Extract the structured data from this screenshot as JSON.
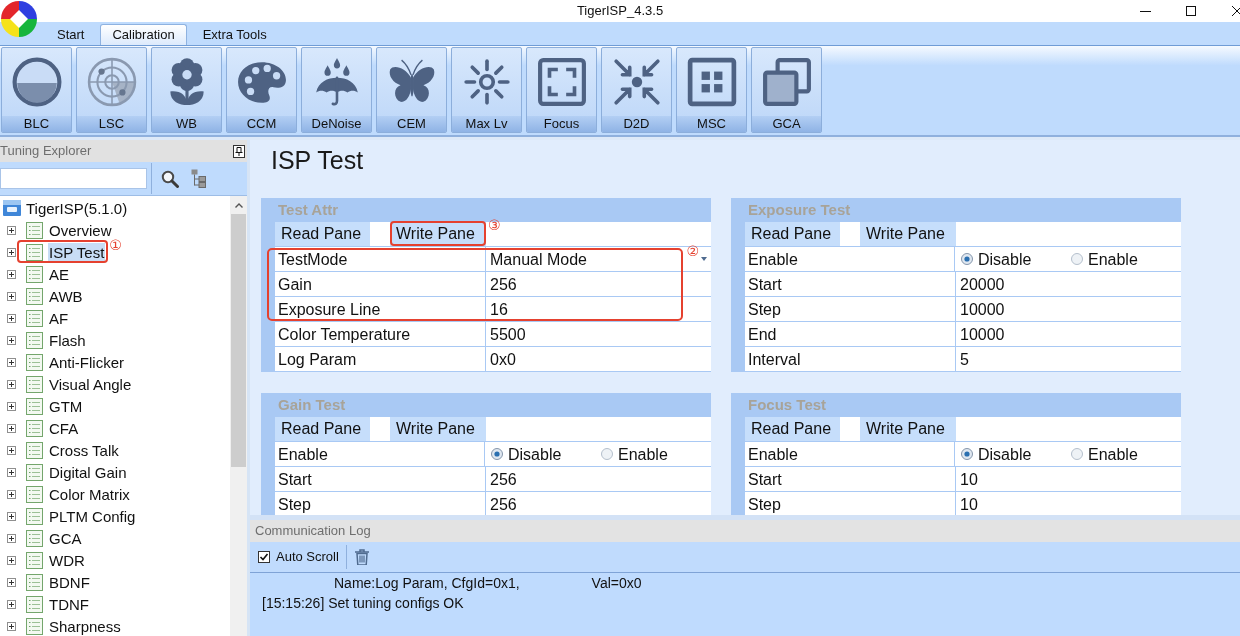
{
  "window": {
    "title": "TigerISP_4.3.5"
  },
  "ribbon_tabs": [
    {
      "label": "Start",
      "selected": false
    },
    {
      "label": "Calibration",
      "selected": true
    },
    {
      "label": "Extra Tools",
      "selected": false
    }
  ],
  "ribbon_buttons": [
    {
      "label": "BLC",
      "kind": "blc"
    },
    {
      "label": "LSC",
      "kind": "lsc"
    },
    {
      "label": "WB",
      "kind": "wb"
    },
    {
      "label": "CCM",
      "kind": "ccm"
    },
    {
      "label": "DeNoise",
      "kind": "denoise"
    },
    {
      "label": "CEM",
      "kind": "cem"
    },
    {
      "label": "Max Lv",
      "kind": "maxlv"
    },
    {
      "label": "Focus",
      "kind": "focus"
    },
    {
      "label": "D2D",
      "kind": "d2d"
    },
    {
      "label": "MSC",
      "kind": "msc"
    },
    {
      "label": "GCA",
      "kind": "gca"
    }
  ],
  "explorer": {
    "title": "Tuning Explorer",
    "tree": {
      "label": "TigerISP(5.1.0)",
      "children": [
        {
          "label": "Overview",
          "expanded": false,
          "selected": false
        },
        {
          "label": "ISP Test",
          "expanded": false,
          "selected": true,
          "annotation": "①"
        },
        {
          "label": "AE",
          "expanded": false,
          "selected": false
        },
        {
          "label": "AWB",
          "expanded": false,
          "selected": false
        },
        {
          "label": "AF",
          "expanded": false,
          "selected": false
        },
        {
          "label": "Flash",
          "expanded": false,
          "selected": false
        },
        {
          "label": "Anti-Flicker",
          "expanded": false,
          "selected": false
        },
        {
          "label": "Visual Angle",
          "expanded": false,
          "selected": false
        },
        {
          "label": "GTM",
          "expanded": false,
          "selected": false
        },
        {
          "label": "CFA",
          "expanded": false,
          "selected": false
        },
        {
          "label": "Cross Talk",
          "expanded": false,
          "selected": false
        },
        {
          "label": "Digital Gain",
          "expanded": false,
          "selected": false
        },
        {
          "label": "Color Matrix",
          "expanded": false,
          "selected": false
        },
        {
          "label": "PLTM Config",
          "expanded": false,
          "selected": false
        },
        {
          "label": "GCA",
          "expanded": false,
          "selected": false
        },
        {
          "label": "WDR",
          "expanded": false,
          "selected": false
        },
        {
          "label": "BDNF",
          "expanded": false,
          "selected": false
        },
        {
          "label": "TDNF",
          "expanded": false,
          "selected": false
        },
        {
          "label": "Sharpness",
          "expanded": false,
          "selected": false
        }
      ]
    }
  },
  "page": {
    "title": "ISP Test",
    "panels": [
      {
        "title": "Test Attr",
        "tabs": [
          {
            "label": "Read Pane"
          },
          {
            "label": "Write Pane",
            "annotation": "③"
          }
        ],
        "annotation": "②",
        "rows": [
          {
            "label": "TestMode",
            "kind": "select",
            "value": "Manual Mode",
            "annotated": true
          },
          {
            "label": "Gain",
            "kind": "text",
            "value": "256",
            "annotated": true
          },
          {
            "label": "Exposure Line",
            "kind": "text",
            "value": "16",
            "annotated": true
          },
          {
            "label": "Color Temperature",
            "kind": "text",
            "value": "5500",
            "annotated": false
          },
          {
            "label": "Log Param",
            "kind": "text",
            "value": "0x0",
            "annotated": false
          }
        ]
      },
      {
        "title": "Exposure Test",
        "tabs": [
          {
            "label": "Read Pane"
          },
          {
            "label": "Write Pane"
          }
        ],
        "rows": [
          {
            "label": "Enable",
            "kind": "radio",
            "options": [
              {
                "label": "Disable",
                "selected": true
              },
              {
                "label": "Enable",
                "selected": false
              }
            ],
            "annotated": false
          },
          {
            "label": "Start",
            "kind": "text",
            "value": "20000",
            "annotated": false
          },
          {
            "label": "Step",
            "kind": "text",
            "value": "10000",
            "annotated": false
          },
          {
            "label": "End",
            "kind": "text",
            "value": "10000",
            "annotated": false
          },
          {
            "label": "Interval",
            "kind": "text",
            "value": "5",
            "annotated": false
          }
        ]
      },
      {
        "title": "Gain Test",
        "tabs": [
          {
            "label": "Read Pane"
          },
          {
            "label": "Write Pane"
          }
        ],
        "rows": [
          {
            "label": "Enable",
            "kind": "radio",
            "options": [
              {
                "label": "Disable",
                "selected": true
              },
              {
                "label": "Enable",
                "selected": false
              }
            ],
            "annotated": false
          },
          {
            "label": "Start",
            "kind": "text",
            "value": "256",
            "annotated": false
          },
          {
            "label": "Step",
            "kind": "text",
            "value": "256",
            "annotated": false
          }
        ]
      },
      {
        "title": "Focus Test",
        "tabs": [
          {
            "label": "Read Pane"
          },
          {
            "label": "Write Pane"
          }
        ],
        "rows": [
          {
            "label": "Enable",
            "kind": "radio",
            "options": [
              {
                "label": "Disable",
                "selected": true
              },
              {
                "label": "Enable",
                "selected": false
              }
            ],
            "annotated": false
          },
          {
            "label": "Start",
            "kind": "text",
            "value": "10",
            "annotated": false
          },
          {
            "label": "Step",
            "kind": "text",
            "value": "10",
            "annotated": false
          }
        ]
      }
    ]
  },
  "log": {
    "title": "Communication Log",
    "auto_scroll": {
      "label": "Auto Scroll",
      "checked": true
    },
    "lines": [
      {
        "kind": "detail",
        "parts": [
          "Name:Log Param, CfgId=0x1,",
          "Val=0x0"
        ]
      },
      {
        "kind": "message",
        "parts": [
          "[15:15:26] Set tuning configs OK"
        ]
      }
    ]
  }
}
